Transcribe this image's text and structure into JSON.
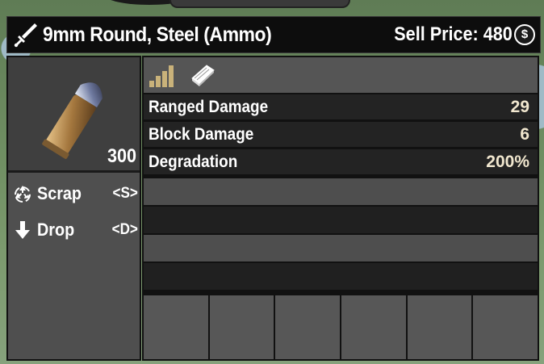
{
  "item": {
    "title": "9mm Round, Steel (Ammo)",
    "sell_price_label": "Sell Price: 480",
    "currency_symbol": "$",
    "quantity": "300"
  },
  "actions": [
    {
      "label": "Scrap",
      "key": "<S>",
      "icon": "recycle-icon"
    },
    {
      "label": "Drop",
      "key": "<D>",
      "icon": "down-arrow-icon"
    }
  ],
  "header_icons": [
    "quality-bars-icon",
    "book-icon"
  ],
  "stats": [
    {
      "name": "Ranged Damage",
      "value": "29"
    },
    {
      "name": "Block Damage",
      "value": "6"
    },
    {
      "name": "Degradation",
      "value": "200%"
    }
  ],
  "colors": {
    "quality_bars": "#c9b27a",
    "stat_value": "#f1e7cf",
    "header_bg": "#0d0d0d"
  }
}
